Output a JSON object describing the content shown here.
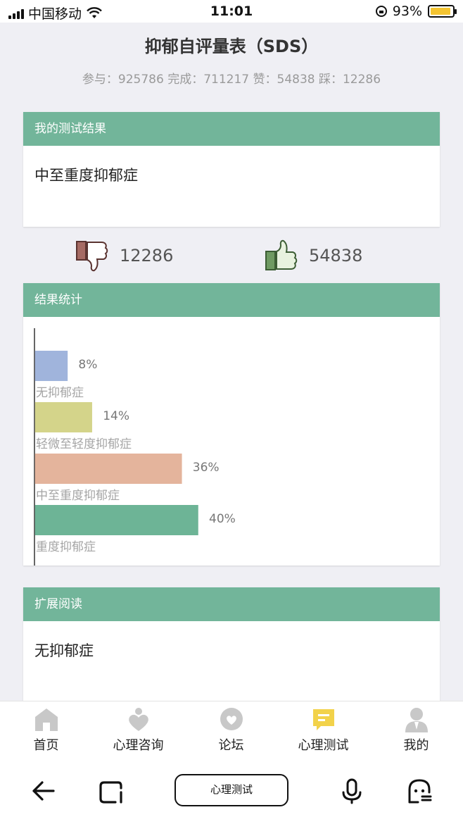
{
  "status_bar": {
    "carrier": "中国移动",
    "time": "11:01",
    "battery": "93%",
    "battery_level": 0.93
  },
  "header": {
    "title": "抑郁自评量表（SDS）",
    "stats": "参与：925786 完成：711217 赞：54838 踩：12286"
  },
  "result_card": {
    "header": "我的测试结果",
    "result": "中至重度抑郁症"
  },
  "votes": {
    "dislike_count": "12286",
    "like_count": "54838",
    "dislike_icon": "thumbs-down-icon",
    "like_icon": "thumbs-up-icon"
  },
  "stats_card": {
    "header": "结果统计"
  },
  "chart_data": {
    "type": "bar",
    "orientation": "horizontal",
    "categories": [
      "无抑郁症",
      "轻微至轻度抑郁症",
      "中至重度抑郁症",
      "重度抑郁症"
    ],
    "values": [
      8,
      14,
      36,
      40
    ],
    "value_labels": [
      "8%",
      "14%",
      "36%",
      "40%"
    ],
    "colors": [
      "#a0b4dc",
      "#d4d48a",
      "#e4b49c",
      "#6db496"
    ],
    "unit": "%",
    "grid": false
  },
  "reading_card": {
    "header": "扩展阅读",
    "text": "无抑郁症"
  },
  "tab_bar": {
    "items": [
      {
        "label": "首页",
        "icon": "home-icon"
      },
      {
        "label": "心理咨询",
        "icon": "consult-icon"
      },
      {
        "label": "论坛",
        "icon": "forum-icon"
      },
      {
        "label": "心理测试",
        "icon": "test-icon",
        "active": true
      },
      {
        "label": "我的",
        "icon": "profile-icon"
      }
    ],
    "active_color": "#f2d24a",
    "inactive_color": "#c8c8c8"
  },
  "browser_bar": {
    "center_label": "心理测试"
  }
}
